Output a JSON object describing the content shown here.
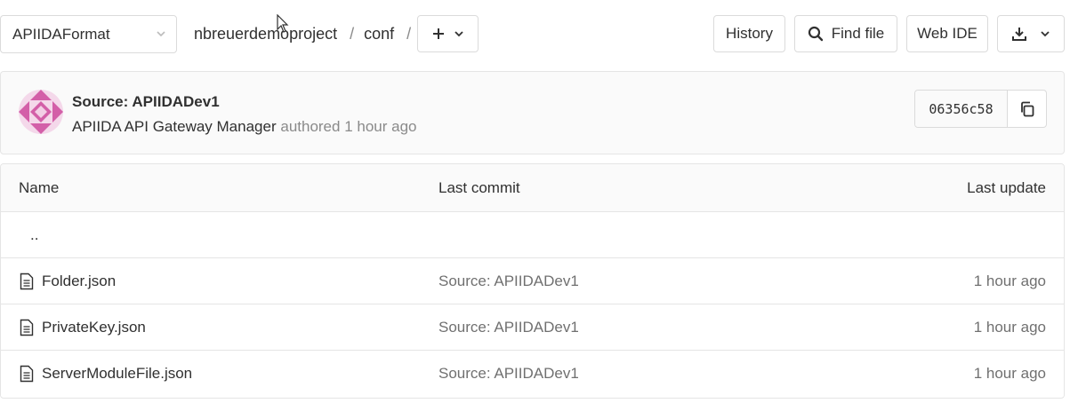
{
  "toolbar": {
    "branch": "APIIDAFormat",
    "breadcrumb": [
      {
        "label": "nbreuerdemoproject"
      },
      {
        "label": "conf"
      }
    ],
    "separator": "/",
    "buttons": {
      "history": "History",
      "find_file": "Find file",
      "web_ide": "Web IDE"
    }
  },
  "commit": {
    "title": "Source: APIIDADev1",
    "author": "APIIDA API Gateway Manager",
    "action": "authored",
    "time": "1 hour ago",
    "sha": "06356c58"
  },
  "table": {
    "headers": {
      "name": "Name",
      "last_commit": "Last commit",
      "last_update": "Last update"
    },
    "parent_link": "..",
    "rows": [
      {
        "name": "Folder.json",
        "commit": "Source: APIIDADev1",
        "updated": "1 hour ago"
      },
      {
        "name": "PrivateKey.json",
        "commit": "Source: APIIDADev1",
        "updated": "1 hour ago"
      },
      {
        "name": "ServerModuleFile.json",
        "commit": "Source: APIIDADev1",
        "updated": "1 hour ago"
      }
    ]
  },
  "colors": {
    "border": "#dbdbdb",
    "muted_text": "#8a8a8a",
    "avatar_pink": "#d35fa8"
  }
}
